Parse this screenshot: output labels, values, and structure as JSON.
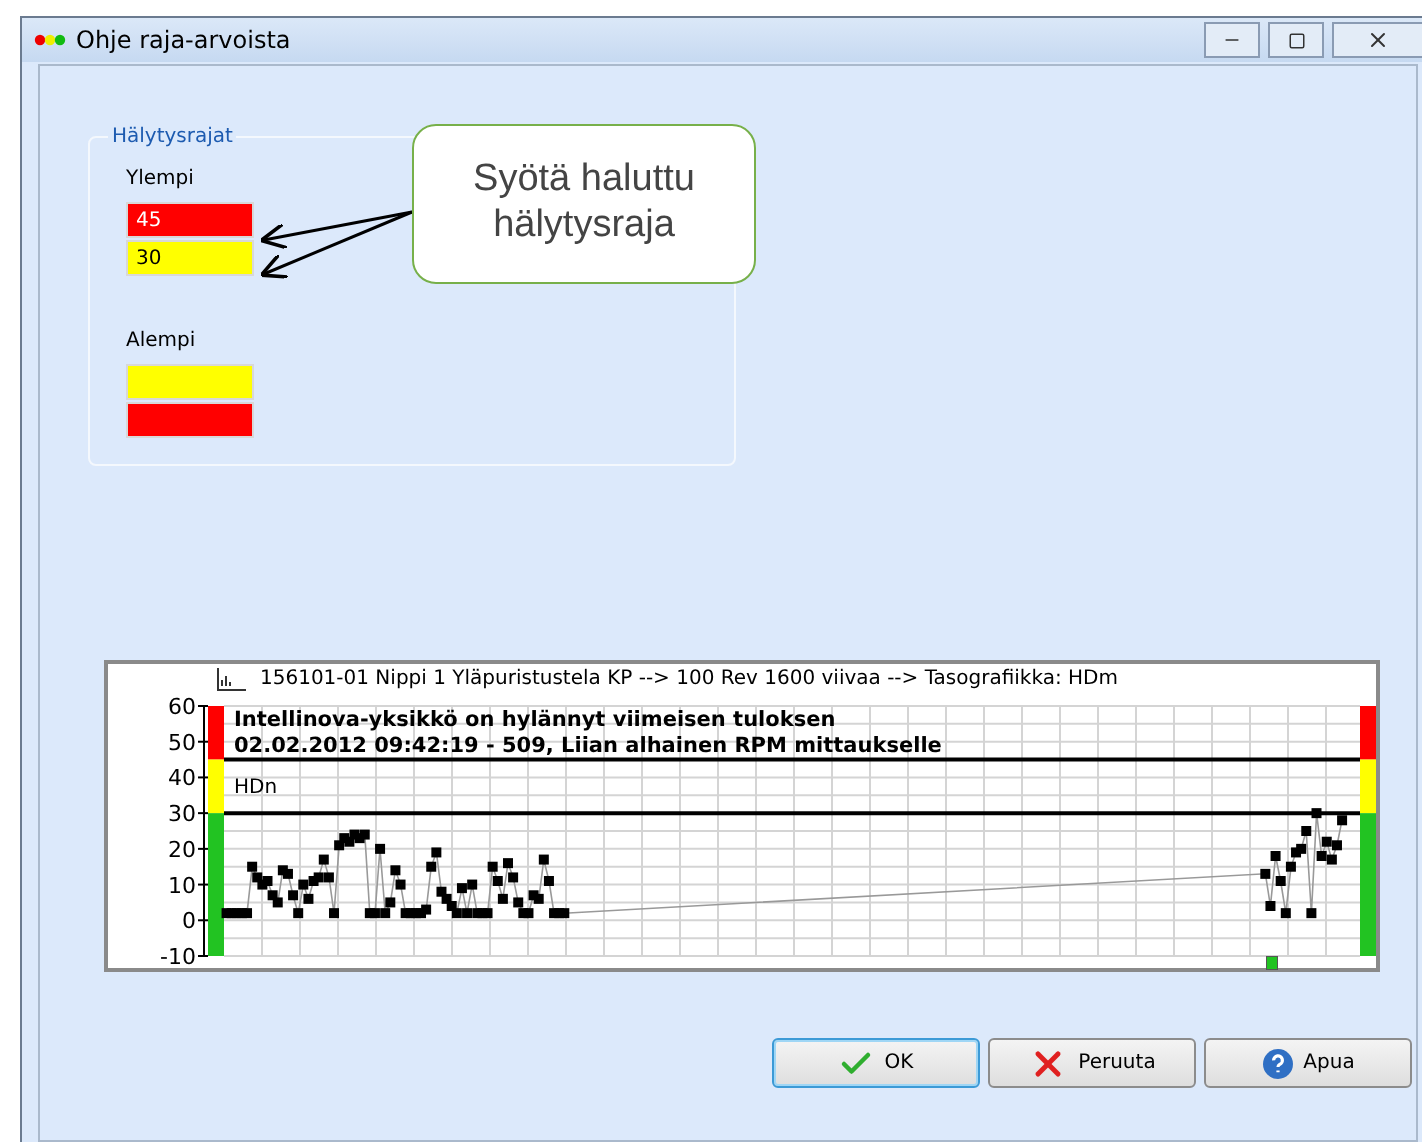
{
  "window": {
    "title": "Ohje raja-arvoista"
  },
  "alarm_limits": {
    "title": "Hälytysrajat",
    "upper_label": "Ylempi",
    "upper": [
      {
        "value": "45",
        "color": "#ff0000"
      },
      {
        "value": "30",
        "color": "#ffff00"
      }
    ],
    "lower_label": "Alempi",
    "lower": [
      {
        "color": "#ffff00"
      },
      {
        "color": "#ff0000"
      }
    ]
  },
  "callout": {
    "text": "Syötä haluttu hälytysraja"
  },
  "chart": {
    "header": "156101-01 Nippi 1 Yläpuristustela KP --> 100 Rev 1600 viivaa --> Tasografiikka: HDm",
    "message_lines": [
      "Intellinova-yksikkö on hylännyt viimeisen tuloksen",
      "02.02.2012 09:42:19 - 509, Liian alhainen RPM mittaukselle"
    ],
    "series_label": "HDn",
    "chart_data": {
      "type": "line",
      "grid": true,
      "ref_lines": [
        {
          "axis": "y",
          "value": 45,
          "color": "#000000"
        },
        {
          "axis": "y",
          "value": 30,
          "color": "#000000"
        }
      ],
      "ylim": [
        -10,
        60
      ],
      "yticks": [
        -10,
        0,
        10,
        20,
        30,
        40,
        50,
        60
      ],
      "categories": [
        null,
        null,
        null,
        null,
        null,
        null,
        null,
        null,
        null,
        null,
        null,
        null,
        null,
        null,
        null,
        null,
        null,
        null,
        null,
        null,
        null,
        null,
        null,
        null,
        null,
        null,
        null,
        null,
        null,
        null,
        null,
        null,
        null,
        null,
        null,
        null,
        null,
        null,
        null,
        null,
        null,
        null,
        null,
        null,
        null,
        null,
        null,
        null,
        null,
        null,
        null,
        null,
        null,
        null,
        null,
        null,
        null,
        null,
        null,
        null,
        null,
        null,
        null,
        null,
        null,
        null,
        null,
        null,
        null,
        null,
        null,
        null,
        null,
        null,
        null,
        null,
        null,
        null,
        null,
        null,
        null,
        null,
        null,
        null,
        null,
        null,
        null,
        null,
        null,
        null,
        null,
        null,
        null,
        null,
        null,
        null,
        null,
        null,
        null,
        null,
        null,
        null,
        null,
        null,
        null,
        null,
        null,
        null,
        null,
        null,
        null,
        null,
        null,
        null,
        null,
        null,
        null,
        null,
        null,
        null,
        null,
        null,
        null,
        null,
        null,
        null,
        null,
        null,
        null,
        null,
        null,
        null,
        null,
        null,
        null,
        null,
        null,
        null,
        null,
        null,
        null,
        null,
        null,
        null,
        null,
        null,
        null,
        null,
        null,
        null,
        null,
        null,
        null,
        null,
        null,
        null,
        null,
        null,
        null,
        null,
        null,
        null,
        null,
        null,
        null,
        null,
        null,
        null,
        null,
        null,
        null,
        null,
        null,
        null,
        null,
        null,
        null,
        null,
        null,
        null,
        null,
        null,
        null,
        null,
        null,
        null,
        null,
        null,
        null,
        null,
        null,
        null,
        null,
        null,
        null,
        null,
        null,
        null,
        null,
        null,
        null,
        null,
        null,
        null,
        null,
        null,
        null,
        null,
        null,
        null,
        null,
        null,
        null,
        null,
        null,
        null,
        null,
        null,
        null,
        null,
        null,
        null
      ],
      "series": [
        {
          "color": "#999999",
          "marker": "square",
          "values": [
            2,
            2,
            2,
            2,
            2,
            15,
            12,
            10,
            11,
            7,
            5,
            14,
            13,
            7,
            2,
            10,
            6,
            11,
            12,
            17,
            12,
            2,
            21,
            23,
            22,
            24,
            23,
            24,
            2,
            2,
            20,
            2,
            5,
            14,
            10,
            2,
            2,
            2,
            2,
            3,
            15,
            19,
            8,
            6,
            4,
            2,
            9,
            2,
            10,
            2,
            2,
            2,
            15,
            11,
            6,
            16,
            12,
            5,
            2,
            2,
            7,
            6,
            17,
            11,
            2,
            2,
            2,
            null,
            null,
            null,
            null,
            null,
            null,
            null,
            null,
            null,
            null,
            null,
            null,
            null,
            null,
            null,
            null,
            null,
            null,
            null,
            null,
            null,
            null,
            null,
            null,
            null,
            null,
            null,
            null,
            null,
            null,
            null,
            null,
            null,
            null,
            null,
            null,
            null,
            null,
            null,
            null,
            null,
            null,
            null,
            null,
            null,
            null,
            null,
            null,
            null,
            null,
            null,
            null,
            null,
            null,
            null,
            null,
            null,
            null,
            null,
            null,
            null,
            null,
            null,
            null,
            null,
            null,
            null,
            null,
            null,
            null,
            null,
            null,
            null,
            null,
            null,
            null,
            null,
            null,
            null,
            null,
            null,
            null,
            null,
            null,
            null,
            null,
            null,
            null,
            null,
            null,
            null,
            null,
            null,
            null,
            null,
            null,
            null,
            null,
            null,
            null,
            null,
            null,
            null,
            null,
            null,
            null,
            null,
            null,
            null,
            null,
            null,
            null,
            null,
            null,
            null,
            null,
            null,
            null,
            null,
            null,
            null,
            null,
            null,
            null,
            null,
            null,
            null,
            null,
            null,
            null,
            null,
            null,
            null,
            null,
            null,
            null,
            13,
            4,
            18,
            11,
            2,
            15,
            19,
            20,
            25,
            2,
            30,
            18,
            22,
            17,
            21,
            28,
            null,
            null,
            null
          ]
        }
      ]
    }
  },
  "buttons": [
    {
      "label": "OK",
      "kind": "ok",
      "focused": true
    },
    {
      "label": "Peruuta",
      "kind": "cancel",
      "focused": false
    },
    {
      "label": "Apua",
      "kind": "help",
      "focused": false
    }
  ]
}
